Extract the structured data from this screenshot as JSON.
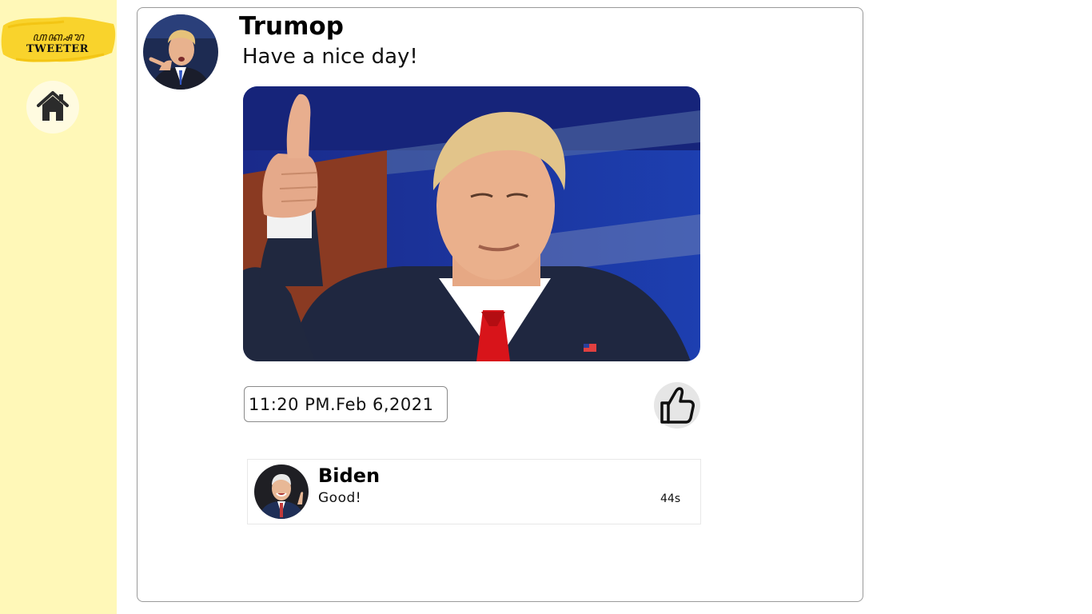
{
  "app": {
    "logo_script": "ꦲꦏ꧀ꦱꦫ",
    "logo_text": "TWEETER"
  },
  "nav": {
    "home_icon": "home-icon"
  },
  "post": {
    "author": "Trumop",
    "text": "Have a nice day!",
    "timestamp": "11:20 PM.Feb 6,2021",
    "like_icon": "thumbs-up-icon"
  },
  "comments": [
    {
      "author": "Biden",
      "text": "Good!",
      "time": "44s"
    }
  ],
  "colors": {
    "sidebar_bg": "#fff8b8",
    "logo_brush": "#f9d32c",
    "card_border": "#9a9a9a",
    "like_bg": "#e6e6e6"
  }
}
